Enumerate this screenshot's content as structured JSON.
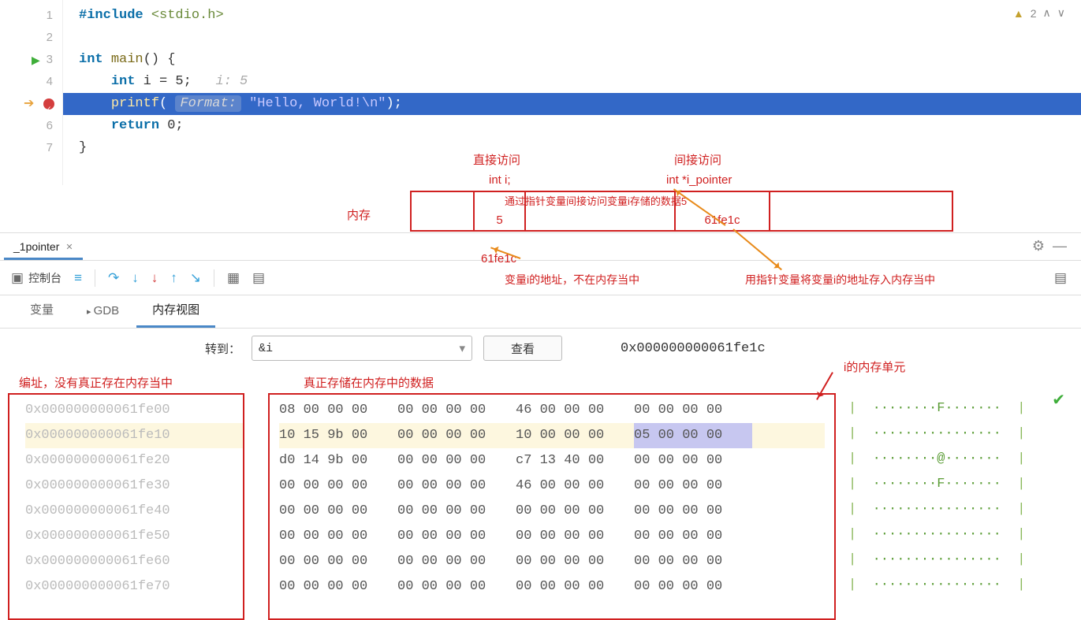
{
  "editor": {
    "warning_count": "2",
    "lines": {
      "l1_inc": "#include",
      "l1_hdr": "<stdio.h>",
      "l3_kw": "int",
      "l3_fn": "main",
      "l3_rest": "() {",
      "l4_kw": "int",
      "l4_rest": " i = 5;",
      "l4_hint": "i: 5",
      "l5_fn": "printf",
      "l5_hint": "Format:",
      "l5_str": "\"Hello, World!\\n\"",
      "l5_rest": ");",
      "l6_kw": "return",
      "l6_rest": " 0;",
      "l7": "}"
    }
  },
  "annotation": {
    "direct_access": "直接访问",
    "indirect_access": "间接访问",
    "int_i": "int i;",
    "int_ip": "int *i_pointer",
    "via_pointer": "通过指针变量间接访问变量i存储的数据5",
    "memory": "内存",
    "val5": "5",
    "addr1": "61fe1c",
    "addr2": "61fe1c",
    "addr_note": "变量i的地址，不在内存当中",
    "ptr_note": "用指针变量将变量i的地址存入内存当中",
    "i_cell": "i的内存单元",
    "编址": "编址，没有真正存在内存当中",
    "real_stored": "真正存储在内存中的数据"
  },
  "tabs": {
    "file_tab": "_1pointer"
  },
  "toolbar": {
    "console": "控制台"
  },
  "subtabs": {
    "vars": "变量",
    "gdb": "GDB",
    "memview": "内存视图"
  },
  "memctrl": {
    "goto_label": "转到：",
    "goto_value": "&i",
    "view_btn": "查看",
    "shown_addr": "0x000000000061fe1c"
  },
  "addresses": [
    "0x000000000061fe00",
    "0x000000000061fe10",
    "0x000000000061fe20",
    "0x000000000061fe30",
    "0x000000000061fe40",
    "0x000000000061fe50",
    "0x000000000061fe60",
    "0x000000000061fe70"
  ],
  "bytes": [
    [
      "08 00 00 00",
      "00 00 00 00",
      "46 00 00 00",
      "00 00 00 00"
    ],
    [
      "10 15 9b 00",
      "00 00 00 00",
      "10 00 00 00",
      "05 00 00 00"
    ],
    [
      "d0 14 9b 00",
      "00 00 00 00",
      "c7 13 40 00",
      "00 00 00 00"
    ],
    [
      "00 00 00 00",
      "00 00 00 00",
      "46 00 00 00",
      "00 00 00 00"
    ],
    [
      "00 00 00 00",
      "00 00 00 00",
      "00 00 00 00",
      "00 00 00 00"
    ],
    [
      "00 00 00 00",
      "00 00 00 00",
      "00 00 00 00",
      "00 00 00 00"
    ],
    [
      "00 00 00 00",
      "00 00 00 00",
      "00 00 00 00",
      "00 00 00 00"
    ],
    [
      "00 00 00 00",
      "00 00 00 00",
      "00 00 00 00",
      "00 00 00 00"
    ]
  ],
  "ascii": [
    "········F·······",
    "················",
    "········@·······",
    "········F·······",
    "················",
    "················",
    "················",
    "················"
  ]
}
